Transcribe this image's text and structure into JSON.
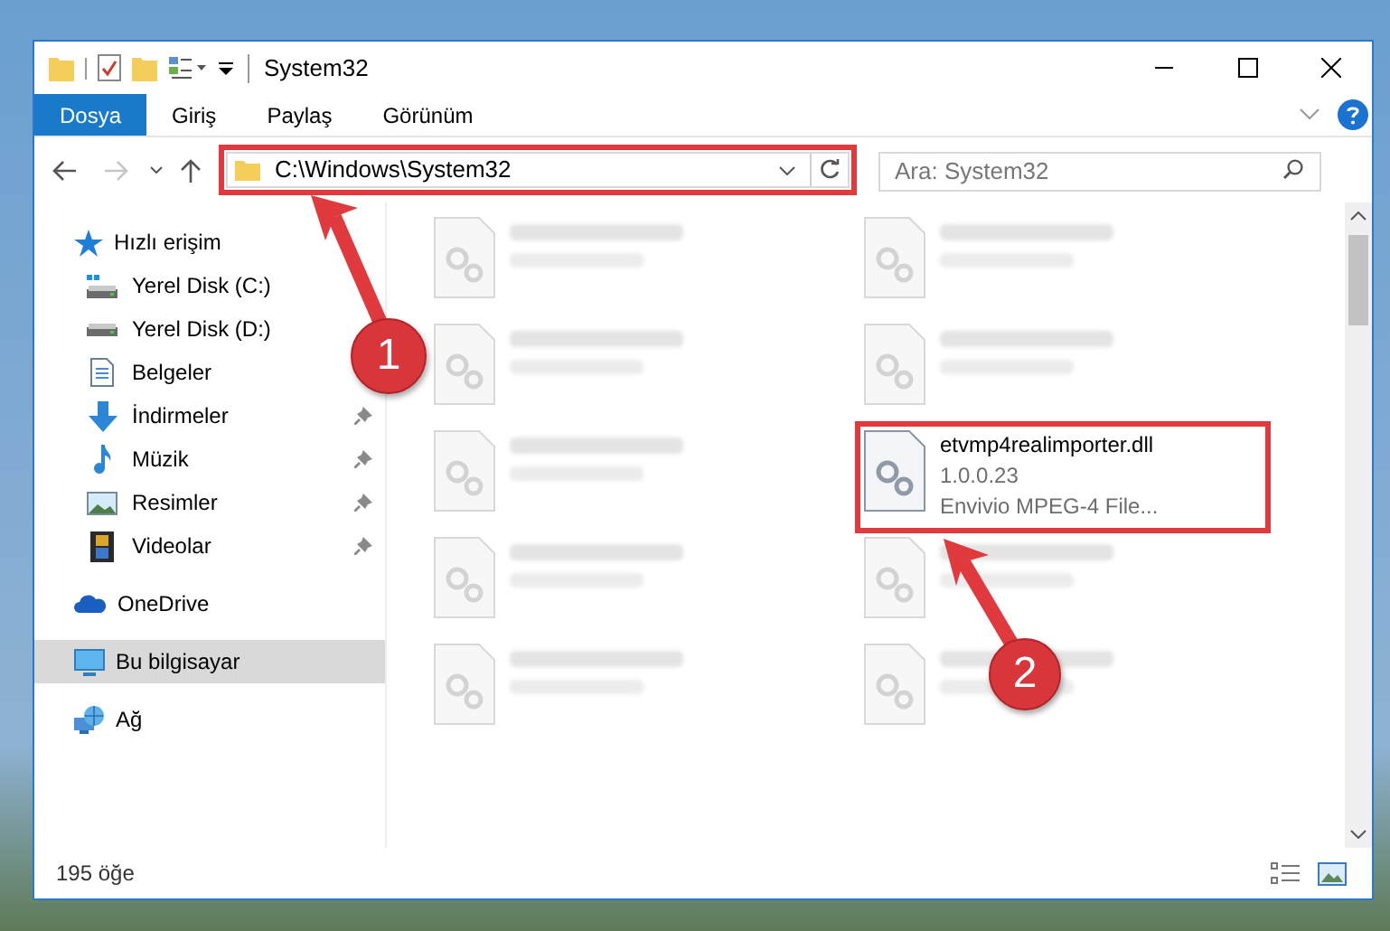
{
  "window": {
    "title": "System32"
  },
  "ribbon_tabs": [
    {
      "label": "Dosya",
      "selected": true
    },
    {
      "label": "Giriş",
      "selected": false
    },
    {
      "label": "Paylaş",
      "selected": false
    },
    {
      "label": "Görünüm",
      "selected": false
    }
  ],
  "address_bar": {
    "path": "C:\\Windows\\System32",
    "highlighted": true
  },
  "search": {
    "placeholder": "Ara: System32"
  },
  "navigation": [
    {
      "label": "Hızlı erişim",
      "selected": false,
      "children": [
        {
          "label": "Yerel Disk (C:)",
          "pinned": false,
          "selected": false
        },
        {
          "label": "Yerel Disk (D:)",
          "pinned": false,
          "selected": false
        },
        {
          "label": "Belgeler",
          "pinned": false,
          "selected": false
        },
        {
          "label": "İndirmeler",
          "pinned": true,
          "selected": false
        },
        {
          "label": "Müzik",
          "pinned": true,
          "selected": false
        },
        {
          "label": "Resimler",
          "pinned": true,
          "selected": false
        },
        {
          "label": "Videolar",
          "pinned": true,
          "selected": false
        }
      ]
    },
    {
      "label": "OneDrive",
      "selected": false
    },
    {
      "label": "Bu bilgisayar",
      "selected": true
    },
    {
      "label": "Ağ",
      "selected": false
    }
  ],
  "files": [
    {
      "blurred": true
    },
    {
      "blurred": true
    },
    {
      "blurred": true
    },
    {
      "blurred": true
    },
    {
      "blurred": true
    },
    {
      "blurred": false,
      "highlighted": true,
      "name": "etvmp4realimporter.dll",
      "details": [
        "1.0.0.23",
        "Envivio MPEG-4 File..."
      ]
    },
    {
      "blurred": true
    },
    {
      "blurred": true
    },
    {
      "blurred": true
    },
    {
      "blurred": true
    }
  ],
  "status_bar": {
    "item_count": "195 öğe"
  },
  "annotations": [
    {
      "label": "1"
    },
    {
      "label": "2"
    }
  ]
}
